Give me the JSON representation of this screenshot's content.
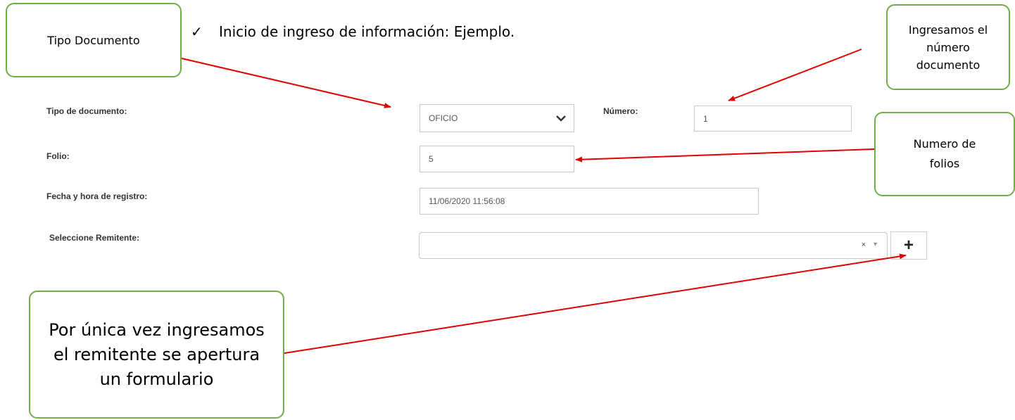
{
  "heading": {
    "check": "✓",
    "text": "Inicio de ingreso de información: Ejemplo."
  },
  "callouts": {
    "tipo_documento": "Tipo Documento",
    "numero_documento": [
      "Ingresamos el",
      "número",
      "documento"
    ],
    "numero_folios": [
      "Numero de",
      "folios"
    ],
    "remitente": [
      "Por única vez ingresamos",
      "el remitente se apertura",
      "un formulario"
    ]
  },
  "form": {
    "tipo_label": "Tipo de documento:",
    "tipo_value": "OFICIO",
    "numero_label": "Número:",
    "numero_value": "1",
    "folio_label": "Folio:",
    "folio_value": "5",
    "fecha_label": "Fecha y hora de registro:",
    "fecha_value": "11/06/2020 11:56:08",
    "remitente_label": "Seleccione Remitente:",
    "remitente_value": "",
    "remitente_clear": "×",
    "remitente_arrow": "▼",
    "add_label": "+"
  },
  "colors": {
    "callout_border": "#70ad47",
    "arrow": "#e00000"
  },
  "icons": {
    "checkmark": "check-icon",
    "tipo_dropdown": "chevron-down-icon",
    "add_remitente": "plus-icon"
  }
}
